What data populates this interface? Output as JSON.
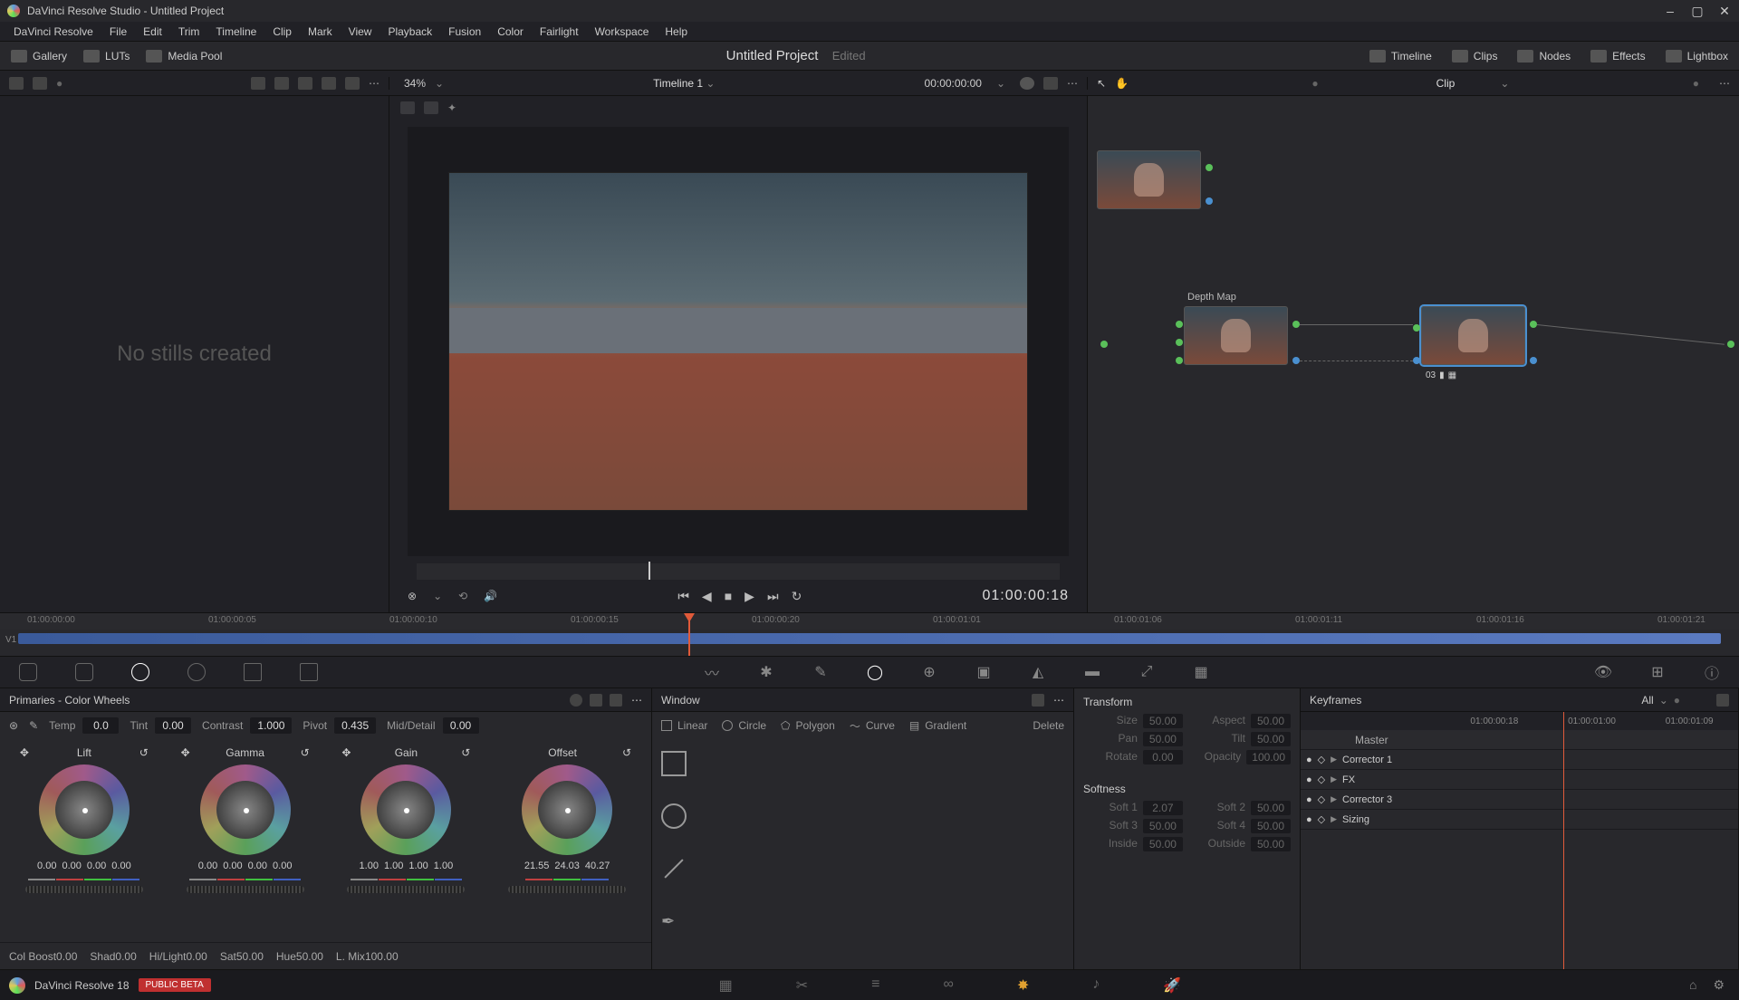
{
  "titlebar": {
    "title": "DaVinci Resolve Studio - Untitled Project"
  },
  "menu": [
    "DaVinci Resolve",
    "File",
    "Edit",
    "Trim",
    "Timeline",
    "Clip",
    "Mark",
    "View",
    "Playback",
    "Fusion",
    "Color",
    "Fairlight",
    "Workspace",
    "Help"
  ],
  "toolbar": {
    "left": [
      "Gallery",
      "LUTs",
      "Media Pool"
    ],
    "project_title": "Untitled Project",
    "edited": "Edited",
    "right": [
      "Timeline",
      "Clips",
      "Nodes",
      "Effects",
      "Lightbox"
    ]
  },
  "subbar": {
    "zoom": "34%",
    "timeline_name": "Timeline 1",
    "timeline_tc": "00:00:00:00",
    "clip_label": "Clip"
  },
  "gallery_msg": "No stills created",
  "transport_tc": "01:00:00:18",
  "node_label": "Depth Map",
  "node_badge": "03",
  "timeline_ruler": [
    "01:00:00:00",
    "01:00:00:05",
    "01:00:00:10",
    "01:00:00:15",
    "01:00:00:20",
    "01:00:01:01",
    "01:00:01:06",
    "01:00:01:11",
    "01:00:01:16",
    "01:00:01:21"
  ],
  "track_label": "V1",
  "primaries": {
    "title": "Primaries - Color Wheels",
    "row1": {
      "temp_l": "Temp",
      "temp": "0.0",
      "tint_l": "Tint",
      "tint": "0.00",
      "contrast_l": "Contrast",
      "contrast": "1.000",
      "pivot_l": "Pivot",
      "pivot": "0.435",
      "md_l": "Mid/Detail",
      "md": "0.00"
    },
    "wheels": {
      "lift": {
        "name": "Lift",
        "vals": [
          "0.00",
          "0.00",
          "0.00",
          "0.00"
        ]
      },
      "gamma": {
        "name": "Gamma",
        "vals": [
          "0.00",
          "0.00",
          "0.00",
          "0.00"
        ]
      },
      "gain": {
        "name": "Gain",
        "vals": [
          "1.00",
          "1.00",
          "1.00",
          "1.00"
        ]
      },
      "offset": {
        "name": "Offset",
        "vals": [
          "21.55",
          "24.03",
          "40.27"
        ]
      }
    },
    "row3": {
      "cb_l": "Col Boost",
      "cb": "0.00",
      "sh_l": "Shad",
      "sh": "0.00",
      "hl_l": "Hi/Light",
      "hl": "0.00",
      "sat_l": "Sat",
      "sat": "50.00",
      "hue_l": "Hue",
      "hue": "50.00",
      "lm_l": "L. Mix",
      "lm": "100.00"
    }
  },
  "window": {
    "title": "Window",
    "tools": {
      "linear": "Linear",
      "circle": "Circle",
      "polygon": "Polygon",
      "curve": "Curve",
      "gradient": "Gradient",
      "delete": "Delete"
    }
  },
  "transform": {
    "title": "Transform",
    "size_l": "Size",
    "size": "50.00",
    "aspect_l": "Aspect",
    "aspect": "50.00",
    "pan_l": "Pan",
    "pan": "50.00",
    "tilt_l": "Tilt",
    "tilt": "50.00",
    "rot_l": "Rotate",
    "rot": "0.00",
    "op_l": "Opacity",
    "op": "100.00",
    "soft_title": "Softness",
    "s1_l": "Soft 1",
    "s1": "2.07",
    "s2_l": "Soft 2",
    "s2": "50.00",
    "s3_l": "Soft 3",
    "s3": "50.00",
    "s4_l": "Soft 4",
    "s4": "50.00",
    "in_l": "Inside",
    "in": "50.00",
    "out_l": "Outside",
    "out": "50.00"
  },
  "keyframes": {
    "title": "Keyframes",
    "all": "All",
    "tc": [
      "01:00:00:18",
      "01:00:01:00",
      "01:00:01:09"
    ],
    "master": "Master",
    "items": [
      "Corrector 1",
      "FX",
      "Corrector 3",
      "Sizing"
    ]
  },
  "pages": {
    "name": "DaVinci Resolve 18",
    "badge": "PUBLIC BETA"
  }
}
